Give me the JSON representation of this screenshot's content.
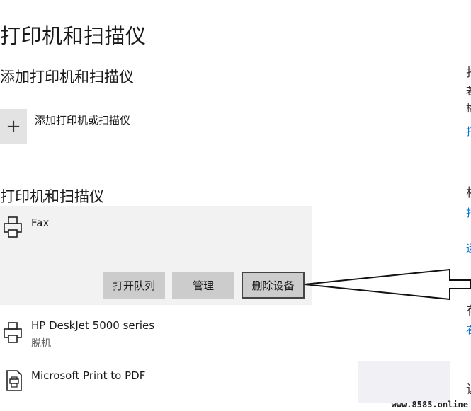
{
  "page": {
    "title": "打印机和扫描仪"
  },
  "add_section": {
    "title": "添加打印机和扫描仪",
    "add_button_label": "添加打印机或扫描仪",
    "add_icon": "plus-icon"
  },
  "devices_section": {
    "title": "打印机和扫描仪",
    "devices": [
      {
        "name": "Fax",
        "status": "",
        "icon": "printer-icon",
        "expanded": true
      },
      {
        "name": "HP DeskJet 5000 series",
        "status": "脱机",
        "icon": "printer-icon",
        "expanded": false
      },
      {
        "name": "Microsoft Print to PDF",
        "status": "",
        "icon": "pdf-printer-icon",
        "expanded": false
      }
    ],
    "actions": {
      "open_queue": "打开队列",
      "manage": "管理",
      "remove_device": "删除设备"
    }
  },
  "right_edge": {
    "fragments": [
      "打",
      "若",
      "格",
      "打",
      "相",
      "打",
      "运",
      "有",
      "看",
      "让"
    ]
  },
  "watermark": "www.8585.online",
  "colors": {
    "accent": "#0078d7",
    "button_bg": "#cccccc",
    "panel_bg": "#f2f2f2",
    "tile_bg": "#e3e3e3"
  }
}
